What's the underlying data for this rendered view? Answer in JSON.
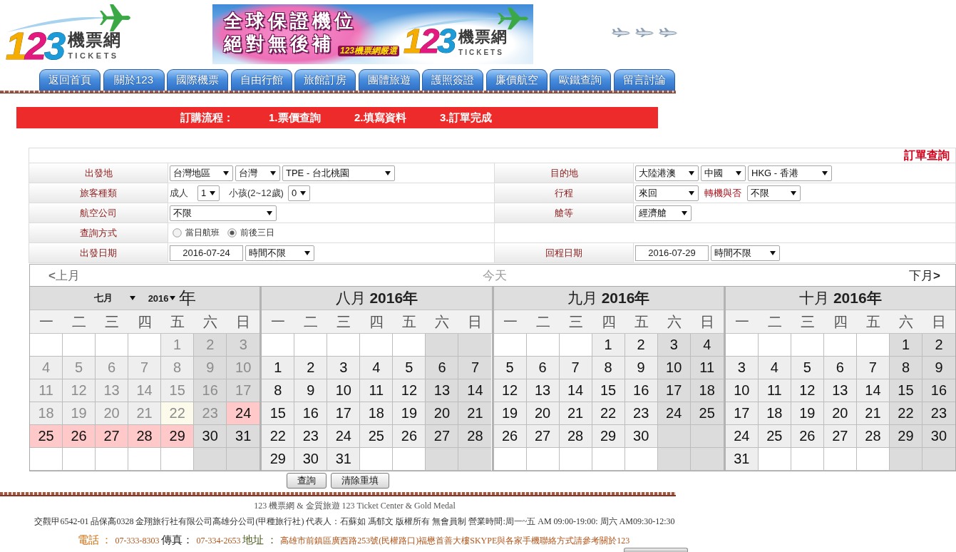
{
  "header": {
    "logo": {
      "number": "123",
      "name": "機票網",
      "subtitle": "TICKETS"
    },
    "banner": {
      "headline": [
        "全球保證機位",
        "絕對無後補"
      ],
      "tagline": "123機票網嚴選",
      "logo": {
        "number": "123",
        "name": "機票網",
        "subtitle": "TICKETS"
      }
    }
  },
  "nav": {
    "tabs": [
      {
        "label": "返回首頁",
        "selected": false
      },
      {
        "label": "關於123",
        "selected": false
      },
      {
        "label": "國際機票",
        "selected": false
      },
      {
        "label": "自由行館",
        "selected": false
      },
      {
        "label": "旅館訂房",
        "selected": false
      },
      {
        "label": "團體旅遊",
        "selected": false
      },
      {
        "label": "護照簽證",
        "selected": false
      },
      {
        "label": "廉價航空",
        "selected": false
      },
      {
        "label": "歐鐵查詢",
        "selected": false
      },
      {
        "label": "留言討論",
        "selected": false
      }
    ]
  },
  "steps": {
    "title": "訂購流程：",
    "items": [
      "1.票價查詢",
      "2.填寫資料",
      "3.訂單完成"
    ]
  },
  "search_form": {
    "order_lookup": "訂單查詢",
    "rows": [
      {
        "cells": [
          {
            "label": "出發地",
            "fields": [
              {
                "kind": "select",
                "value": "台灣地區"
              },
              {
                "kind": "select",
                "value": "台灣"
              },
              {
                "kind": "select",
                "value": "TPE - 台北桃園"
              }
            ]
          },
          {
            "label": "目的地",
            "fields": [
              {
                "kind": "select",
                "value": "大陸港澳"
              },
              {
                "kind": "select",
                "value": "中國"
              },
              {
                "kind": "select",
                "value": "HKG - 香港"
              }
            ]
          }
        ]
      },
      {
        "cells": [
          {
            "label": "旅客種類",
            "fields": [
              {
                "kind": "text",
                "text": "成人"
              },
              {
                "kind": "select",
                "value": "1"
              },
              {
                "kind": "text",
                "text": "小孩(2~12歲)"
              },
              {
                "kind": "select",
                "value": "0"
              }
            ]
          },
          {
            "label": "行程",
            "fields": [
              {
                "kind": "select",
                "value": "來回"
              },
              {
                "kind": "label",
                "text": "轉機與否"
              },
              {
                "kind": "select",
                "value": "不限"
              }
            ]
          }
        ]
      },
      {
        "cells": [
          {
            "label": "航空公司",
            "fields": [
              {
                "kind": "select",
                "value": "不限"
              }
            ]
          },
          {
            "label": "艙等",
            "fields": [
              {
                "kind": "select",
                "value": "經濟艙"
              }
            ]
          }
        ]
      },
      {
        "cells": [
          {
            "label": "查詢方式",
            "fields": [
              {
                "kind": "radio",
                "text": "當日航班",
                "selected": false
              },
              {
                "kind": "radio",
                "text": "前後三日",
                "selected": true
              }
            ]
          }
        ]
      },
      {
        "cells": [
          {
            "label": "出發日期",
            "fields": [
              {
                "kind": "input",
                "value": "2016-07-24"
              },
              {
                "kind": "select",
                "value": "時間不限"
              }
            ]
          },
          {
            "label": "回程日期",
            "fields": [
              {
                "kind": "input",
                "value": "2016-07-29"
              },
              {
                "kind": "select",
                "value": "時間不限"
              }
            ]
          }
        ]
      }
    ]
  },
  "calendar": {
    "prev": "**<**上月",
    "today": "今天",
    "next": "下月**>**",
    "months": [
      {
        "kind": "picker",
        "month": "七月",
        "year": "2016",
        "suffix": "年",
        "weekdays": [
          "一",
          "二",
          "三",
          "四",
          "五",
          "六",
          "日"
        ],
        "weeks": [
          [
            {
              "kind": "blank"
            },
            {
              "kind": "blank"
            },
            {
              "kind": "blank"
            },
            {
              "kind": "blank"
            },
            {
              "kind": "day",
              "day": "1",
              "past": true,
              "today": false,
              "selected": false
            },
            {
              "kind": "day",
              "day": "2",
              "past": true,
              "today": false,
              "selected": false
            },
            {
              "kind": "day",
              "day": "3",
              "past": true,
              "today": false,
              "selected": false
            }
          ],
          [
            {
              "kind": "day",
              "day": "4",
              "past": true,
              "today": false,
              "selected": false
            },
            {
              "kind": "day",
              "day": "5",
              "past": true,
              "today": false,
              "selected": false
            },
            {
              "kind": "day",
              "day": "6",
              "past": true,
              "today": false,
              "selected": false
            },
            {
              "kind": "day",
              "day": "7",
              "past": true,
              "today": false,
              "selected": false
            },
            {
              "kind": "day",
              "day": "8",
              "past": true,
              "today": false,
              "selected": false
            },
            {
              "kind": "day",
              "day": "9",
              "past": true,
              "today": false,
              "selected": false
            },
            {
              "kind": "day",
              "day": "10",
              "past": true,
              "today": false,
              "selected": false
            }
          ],
          [
            {
              "kind": "day",
              "day": "11",
              "past": true,
              "today": false,
              "selected": false
            },
            {
              "kind": "day",
              "day": "12",
              "past": true,
              "today": false,
              "selected": false
            },
            {
              "kind": "day",
              "day": "13",
              "past": true,
              "today": false,
              "selected": false
            },
            {
              "kind": "day",
              "day": "14",
              "past": true,
              "today": false,
              "selected": false
            },
            {
              "kind": "day",
              "day": "15",
              "past": true,
              "today": false,
              "selected": false
            },
            {
              "kind": "day",
              "day": "16",
              "past": true,
              "today": false,
              "selected": false
            },
            {
              "kind": "day",
              "day": "17",
              "past": true,
              "today": false,
              "selected": false
            }
          ],
          [
            {
              "kind": "day",
              "day": "18",
              "past": true,
              "today": false,
              "selected": false
            },
            {
              "kind": "day",
              "day": "19",
              "past": true,
              "today": false,
              "selected": false
            },
            {
              "kind": "day",
              "day": "20",
              "past": true,
              "today": false,
              "selected": false
            },
            {
              "kind": "day",
              "day": "21",
              "past": true,
              "today": false,
              "selected": false
            },
            {
              "kind": "day",
              "day": "22",
              "past": true,
              "today": true,
              "selected": false
            },
            {
              "kind": "day",
              "day": "23",
              "past": true,
              "today": false,
              "selected": false
            },
            {
              "kind": "day",
              "day": "24",
              "past": false,
              "today": false,
              "selected": true
            }
          ],
          [
            {
              "kind": "day",
              "day": "25",
              "past": false,
              "today": false,
              "selected": true
            },
            {
              "kind": "day",
              "day": "26",
              "past": false,
              "today": false,
              "selected": true
            },
            {
              "kind": "day",
              "day": "27",
              "past": false,
              "today": false,
              "selected": true
            },
            {
              "kind": "day",
              "day": "28",
              "past": false,
              "today": false,
              "selected": true
            },
            {
              "kind": "day",
              "day": "29",
              "past": false,
              "today": false,
              "selected": true
            },
            {
              "kind": "day",
              "day": "30",
              "past": false,
              "today": false,
              "selected": false
            },
            {
              "kind": "day",
              "day": "31",
              "past": false,
              "today": false,
              "selected": false
            }
          ],
          [
            {
              "kind": "blank"
            },
            {
              "kind": "blank"
            },
            {
              "kind": "blank"
            },
            {
              "kind": "blank"
            },
            {
              "kind": "blank"
            },
            {
              "kind": "blank"
            },
            {
              "kind": "blank"
            }
          ]
        ]
      },
      {
        "kind": "title",
        "title": "八月 **2016年**",
        "weekdays": [
          "一",
          "二",
          "三",
          "四",
          "五",
          "六",
          "日"
        ],
        "weeks": [
          [
            {
              "kind": "blank"
            },
            {
              "kind": "blank"
            },
            {
              "kind": "blank"
            },
            {
              "kind": "blank"
            },
            {
              "kind": "blank"
            },
            {
              "kind": "blank"
            },
            {
              "kind": "blank"
            }
          ],
          [
            {
              "kind": "day",
              "day": "1",
              "past": false,
              "today": false,
              "selected": false
            },
            {
              "kind": "day",
              "day": "2",
              "past": false,
              "today": false,
              "selected": false
            },
            {
              "kind": "day",
              "day": "3",
              "past": false,
              "today": false,
              "selected": false
            },
            {
              "kind": "day",
              "day": "4",
              "past": false,
              "today": false,
              "selected": false
            },
            {
              "kind": "day",
              "day": "5",
              "past": false,
              "today": false,
              "selected": false
            },
            {
              "kind": "day",
              "day": "6",
              "past": false,
              "today": false,
              "selected": false
            },
            {
              "kind": "day",
              "day": "7",
              "past": false,
              "today": false,
              "selected": false
            }
          ],
          [
            {
              "kind": "day",
              "day": "8",
              "past": false,
              "today": false,
              "selected": false
            },
            {
              "kind": "day",
              "day": "9",
              "past": false,
              "today": false,
              "selected": false
            },
            {
              "kind": "day",
              "day": "10",
              "past": false,
              "today": false,
              "selected": false
            },
            {
              "kind": "day",
              "day": "11",
              "past": false,
              "today": false,
              "selected": false
            },
            {
              "kind": "day",
              "day": "12",
              "past": false,
              "today": false,
              "selected": false
            },
            {
              "kind": "day",
              "day": "13",
              "past": false,
              "today": false,
              "selected": false
            },
            {
              "kind": "day",
              "day": "14",
              "past": false,
              "today": false,
              "selected": false
            }
          ],
          [
            {
              "kind": "day",
              "day": "15",
              "past": false,
              "today": false,
              "selected": false
            },
            {
              "kind": "day",
              "day": "16",
              "past": false,
              "today": false,
              "selected": false
            },
            {
              "kind": "day",
              "day": "17",
              "past": false,
              "today": false,
              "selected": false
            },
            {
              "kind": "day",
              "day": "18",
              "past": false,
              "today": false,
              "selected": false
            },
            {
              "kind": "day",
              "day": "19",
              "past": false,
              "today": false,
              "selected": false
            },
            {
              "kind": "day",
              "day": "20",
              "past": false,
              "today": false,
              "selected": false
            },
            {
              "kind": "day",
              "day": "21",
              "past": false,
              "today": false,
              "selected": false
            }
          ],
          [
            {
              "kind": "day",
              "day": "22",
              "past": false,
              "today": false,
              "selected": false
            },
            {
              "kind": "day",
              "day": "23",
              "past": false,
              "today": false,
              "selected": false
            },
            {
              "kind": "day",
              "day": "24",
              "past": false,
              "today": false,
              "selected": false
            },
            {
              "kind": "day",
              "day": "25",
              "past": false,
              "today": false,
              "selected": false
            },
            {
              "kind": "day",
              "day": "26",
              "past": false,
              "today": false,
              "selected": false
            },
            {
              "kind": "day",
              "day": "27",
              "past": false,
              "today": false,
              "selected": false
            },
            {
              "kind": "day",
              "day": "28",
              "past": false,
              "today": false,
              "selected": false
            }
          ],
          [
            {
              "kind": "day",
              "day": "29",
              "past": false,
              "today": false,
              "selected": false
            },
            {
              "kind": "day",
              "day": "30",
              "past": false,
              "today": false,
              "selected": false
            },
            {
              "kind": "day",
              "day": "31",
              "past": false,
              "today": false,
              "selected": false
            },
            {
              "kind": "blank"
            },
            {
              "kind": "blank"
            },
            {
              "kind": "blank"
            },
            {
              "kind": "blank"
            }
          ]
        ]
      },
      {
        "kind": "title",
        "title": "九月 **2016年**",
        "weekdays": [
          "一",
          "二",
          "三",
          "四",
          "五",
          "六",
          "日"
        ],
        "weeks": [
          [
            {
              "kind": "blank"
            },
            {
              "kind": "blank"
            },
            {
              "kind": "blank"
            },
            {
              "kind": "day",
              "day": "1",
              "past": false,
              "today": false,
              "selected": false
            },
            {
              "kind": "day",
              "day": "2",
              "past": false,
              "today": false,
              "selected": false
            },
            {
              "kind": "day",
              "day": "3",
              "past": false,
              "today": false,
              "selected": false
            },
            {
              "kind": "day",
              "day": "4",
              "past": false,
              "today": false,
              "selected": false
            }
          ],
          [
            {
              "kind": "day",
              "day": "5",
              "past": false,
              "today": false,
              "selected": false
            },
            {
              "kind": "day",
              "day": "6",
              "past": false,
              "today": false,
              "selected": false
            },
            {
              "kind": "day",
              "day": "7",
              "past": false,
              "today": false,
              "selected": false
            },
            {
              "kind": "day",
              "day": "8",
              "past": false,
              "today": false,
              "selected": false
            },
            {
              "kind": "day",
              "day": "9",
              "past": false,
              "today": false,
              "selected": false
            },
            {
              "kind": "day",
              "day": "10",
              "past": false,
              "today": false,
              "selected": false
            },
            {
              "kind": "day",
              "day": "11",
              "past": false,
              "today": false,
              "selected": false
            }
          ],
          [
            {
              "kind": "day",
              "day": "12",
              "past": false,
              "today": false,
              "selected": false
            },
            {
              "kind": "day",
              "day": "13",
              "past": false,
              "today": false,
              "selected": false
            },
            {
              "kind": "day",
              "day": "14",
              "past": false,
              "today": false,
              "selected": false
            },
            {
              "kind": "day",
              "day": "15",
              "past": false,
              "today": false,
              "selected": false
            },
            {
              "kind": "day",
              "day": "16",
              "past": false,
              "today": false,
              "selected": false
            },
            {
              "kind": "day",
              "day": "17",
              "past": false,
              "today": false,
              "selected": false
            },
            {
              "kind": "day",
              "day": "18",
              "past": false,
              "today": false,
              "selected": false
            }
          ],
          [
            {
              "kind": "day",
              "day": "19",
              "past": false,
              "today": false,
              "selected": false
            },
            {
              "kind": "day",
              "day": "20",
              "past": false,
              "today": false,
              "selected": false
            },
            {
              "kind": "day",
              "day": "21",
              "past": false,
              "today": false,
              "selected": false
            },
            {
              "kind": "day",
              "day": "22",
              "past": false,
              "today": false,
              "selected": false
            },
            {
              "kind": "day",
              "day": "23",
              "past": false,
              "today": false,
              "selected": false
            },
            {
              "kind": "day",
              "day": "24",
              "past": false,
              "today": false,
              "selected": false
            },
            {
              "kind": "day",
              "day": "25",
              "past": false,
              "today": false,
              "selected": false
            }
          ],
          [
            {
              "kind": "day",
              "day": "26",
              "past": false,
              "today": false,
              "selected": false
            },
            {
              "kind": "day",
              "day": "27",
              "past": false,
              "today": false,
              "selected": false
            },
            {
              "kind": "day",
              "day": "28",
              "past": false,
              "today": false,
              "selected": false
            },
            {
              "kind": "day",
              "day": "29",
              "past": false,
              "today": false,
              "selected": false
            },
            {
              "kind": "day",
              "day": "30",
              "past": false,
              "today": false,
              "selected": false
            },
            {
              "kind": "blank"
            },
            {
              "kind": "blank"
            }
          ],
          [
            {
              "kind": "blank"
            },
            {
              "kind": "blank"
            },
            {
              "kind": "blank"
            },
            {
              "kind": "blank"
            },
            {
              "kind": "blank"
            },
            {
              "kind": "blank"
            },
            {
              "kind": "blank"
            }
          ]
        ]
      },
      {
        "kind": "title",
        "title": "十月 **2016年**",
        "weekdays": [
          "一",
          "二",
          "三",
          "四",
          "五",
          "六",
          "日"
        ],
        "weeks": [
          [
            {
              "kind": "blank"
            },
            {
              "kind": "blank"
            },
            {
              "kind": "blank"
            },
            {
              "kind": "blank"
            },
            {
              "kind": "blank"
            },
            {
              "kind": "day",
              "day": "1",
              "past": false,
              "today": false,
              "selected": false
            },
            {
              "kind": "day",
              "day": "2",
              "past": false,
              "today": false,
              "selected": false
            }
          ],
          [
            {
              "kind": "day",
              "day": "3",
              "past": false,
              "today": false,
              "selected": false
            },
            {
              "kind": "day",
              "day": "4",
              "past": false,
              "today": false,
              "selected": false
            },
            {
              "kind": "day",
              "day": "5",
              "past": false,
              "today": false,
              "selected": false
            },
            {
              "kind": "day",
              "day": "6",
              "past": false,
              "today": false,
              "selected": false
            },
            {
              "kind": "day",
              "day": "7",
              "past": false,
              "today": false,
              "selected": false
            },
            {
              "kind": "day",
              "day": "8",
              "past": false,
              "today": false,
              "selected": false
            },
            {
              "kind": "day",
              "day": "9",
              "past": false,
              "today": false,
              "selected": false
            }
          ],
          [
            {
              "kind": "day",
              "day": "10",
              "past": false,
              "today": false,
              "selected": false
            },
            {
              "kind": "day",
              "day": "11",
              "past": false,
              "today": false,
              "selected": false
            },
            {
              "kind": "day",
              "day": "12",
              "past": false,
              "today": false,
              "selected": false
            },
            {
              "kind": "day",
              "day": "13",
              "past": false,
              "today": false,
              "selected": false
            },
            {
              "kind": "day",
              "day": "14",
              "past": false,
              "today": false,
              "selected": false
            },
            {
              "kind": "day",
              "day": "15",
              "past": false,
              "today": false,
              "selected": false
            },
            {
              "kind": "day",
              "day": "16",
              "past": false,
              "today": false,
              "selected": false
            }
          ],
          [
            {
              "kind": "day",
              "day": "17",
              "past": false,
              "today": false,
              "selected": false
            },
            {
              "kind": "day",
              "day": "18",
              "past": false,
              "today": false,
              "selected": false
            },
            {
              "kind": "day",
              "day": "19",
              "past": false,
              "today": false,
              "selected": false
            },
            {
              "kind": "day",
              "day": "20",
              "past": false,
              "today": false,
              "selected": false
            },
            {
              "kind": "day",
              "day": "21",
              "past": false,
              "today": false,
              "selected": false
            },
            {
              "kind": "day",
              "day": "22",
              "past": false,
              "today": false,
              "selected": false
            },
            {
              "kind": "day",
              "day": "23",
              "past": false,
              "today": false,
              "selected": false
            }
          ],
          [
            {
              "kind": "day",
              "day": "24",
              "past": false,
              "today": false,
              "selected": false
            },
            {
              "kind": "day",
              "day": "25",
              "past": false,
              "today": false,
              "selected": false
            },
            {
              "kind": "day",
              "day": "26",
              "past": false,
              "today": false,
              "selected": false
            },
            {
              "kind": "day",
              "day": "27",
              "past": false,
              "today": false,
              "selected": false
            },
            {
              "kind": "day",
              "day": "28",
              "past": false,
              "today": false,
              "selected": false
            },
            {
              "kind": "day",
              "day": "29",
              "past": false,
              "today": false,
              "selected": false
            },
            {
              "kind": "day",
              "day": "30",
              "past": false,
              "today": false,
              "selected": false
            }
          ],
          [
            {
              "kind": "day",
              "day": "31",
              "past": false,
              "today": false,
              "selected": false
            },
            {
              "kind": "blank"
            },
            {
              "kind": "blank"
            },
            {
              "kind": "blank"
            },
            {
              "kind": "blank"
            },
            {
              "kind": "blank"
            },
            {
              "kind": "blank"
            }
          ]
        ]
      }
    ]
  },
  "buttons": [
    "查詢",
    "清除重填"
  ],
  "footer": {
    "title_line": "123 機票網 & 金質旅遊 123 Ticket Center & Gold Medal",
    "info_line": "交觀甲6542-01 品保高0328 金翔旅行社有限公司高雄分公司(甲種旅行社) 代表人：石蘇如 馮郁文 版權所有 無會員制 營業時間:周一~五 AM 09:00-19:00: 周六 AM09:30-12:30",
    "contact": [
      {
        "label": "電話 ：",
        "value": "07-333-8303"
      },
      {
        "label": "傳真：",
        "value": "07-334-2653"
      },
      {
        "label": "地址 ：",
        "value": "高雄市前鎮區廣西路253號(民權路口)福懋首善大樓SKYPE與各家手機聯絡方式請參考關於123"
      }
    ]
  }
}
